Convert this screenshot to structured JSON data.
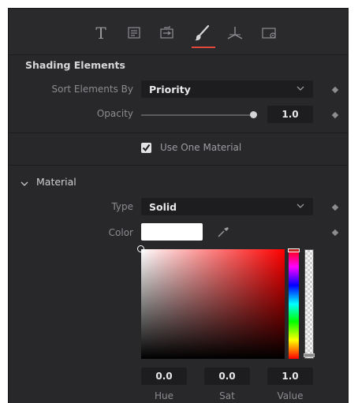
{
  "tabs": [
    {
      "name": "text-tab",
      "icon": "text-T-icon",
      "label": "T"
    },
    {
      "name": "layout-tab",
      "icon": "layout-list-icon"
    },
    {
      "name": "transform-tab",
      "icon": "transform-icon"
    },
    {
      "name": "shading-tab",
      "icon": "paintbrush-icon",
      "active": true
    },
    {
      "name": "3d-tab",
      "icon": "axes-3d-icon"
    },
    {
      "name": "settings-tab",
      "icon": "settings-gear-icon"
    }
  ],
  "shading": {
    "section_title": "Shading Elements",
    "sort_label": "Sort Elements By",
    "sort_value": "Priority",
    "opacity_label": "Opacity",
    "opacity_value": "1.0",
    "use_one_material_label": "Use One Material",
    "use_one_material_checked": true
  },
  "material": {
    "section_title": "Material",
    "type_label": "Type",
    "type_value": "Solid",
    "color_label": "Color",
    "color_swatch": "#ffffff",
    "hue_value": "0.0",
    "sat_value": "0.0",
    "value_value": "1.0",
    "hue_label": "Hue",
    "sat_label": "Sat",
    "value_label": "Value"
  },
  "colors": {
    "panel_bg": "#28282b",
    "field_bg": "#1d1d20",
    "accent": "#e0483c"
  }
}
